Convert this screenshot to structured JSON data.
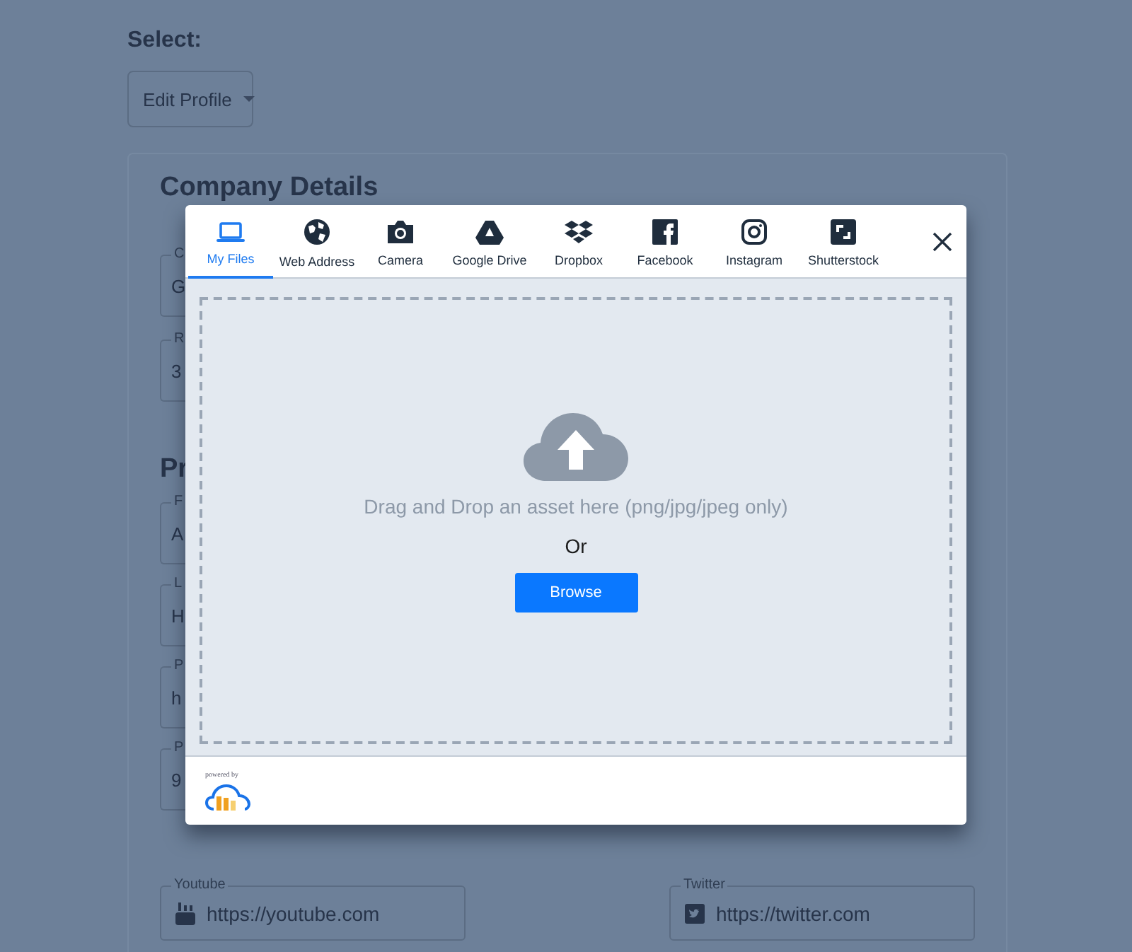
{
  "page": {
    "select_label": "Select:",
    "select": {
      "value": "Edit Profile"
    },
    "sections": [
      {
        "title": "Company Details",
        "fields": [
          {
            "label": "C",
            "value": "G"
          },
          {
            "label": "R",
            "value": "3"
          }
        ]
      },
      {
        "title": "Pr",
        "fields": [
          {
            "label": "F",
            "value": "A"
          },
          {
            "label": "L",
            "value": "H"
          },
          {
            "label": "P",
            "value": "h"
          },
          {
            "label": "P",
            "value": "9"
          }
        ]
      }
    ],
    "social_fields": [
      {
        "label": "Youtube",
        "value": "https://youtube.com",
        "kind": "youtube"
      },
      {
        "label": "Twitter",
        "value": "https://twitter.com",
        "kind": "twitter"
      }
    ]
  },
  "upload_dialog": {
    "tabs": [
      {
        "label": "My Files",
        "kind": "laptop",
        "selected": true
      },
      {
        "label": "Web Address",
        "kind": "globe",
        "selected": false
      },
      {
        "label": "Camera",
        "kind": "camera",
        "selected": false
      },
      {
        "label": "Google Drive",
        "kind": "drive",
        "selected": false
      },
      {
        "label": "Dropbox",
        "kind": "dropbox",
        "selected": false
      },
      {
        "label": "Facebook",
        "kind": "facebook",
        "selected": false
      },
      {
        "label": "Instagram",
        "kind": "instagram",
        "selected": false
      },
      {
        "label": "Shutterstock",
        "kind": "shutterstock",
        "selected": false
      }
    ],
    "drop_zone": {
      "message": "Drag and Drop an asset here (png/jpg/jpeg only)",
      "or": "Or",
      "button": "Browse"
    },
    "footer": {
      "powered_by": "powered by"
    }
  }
}
